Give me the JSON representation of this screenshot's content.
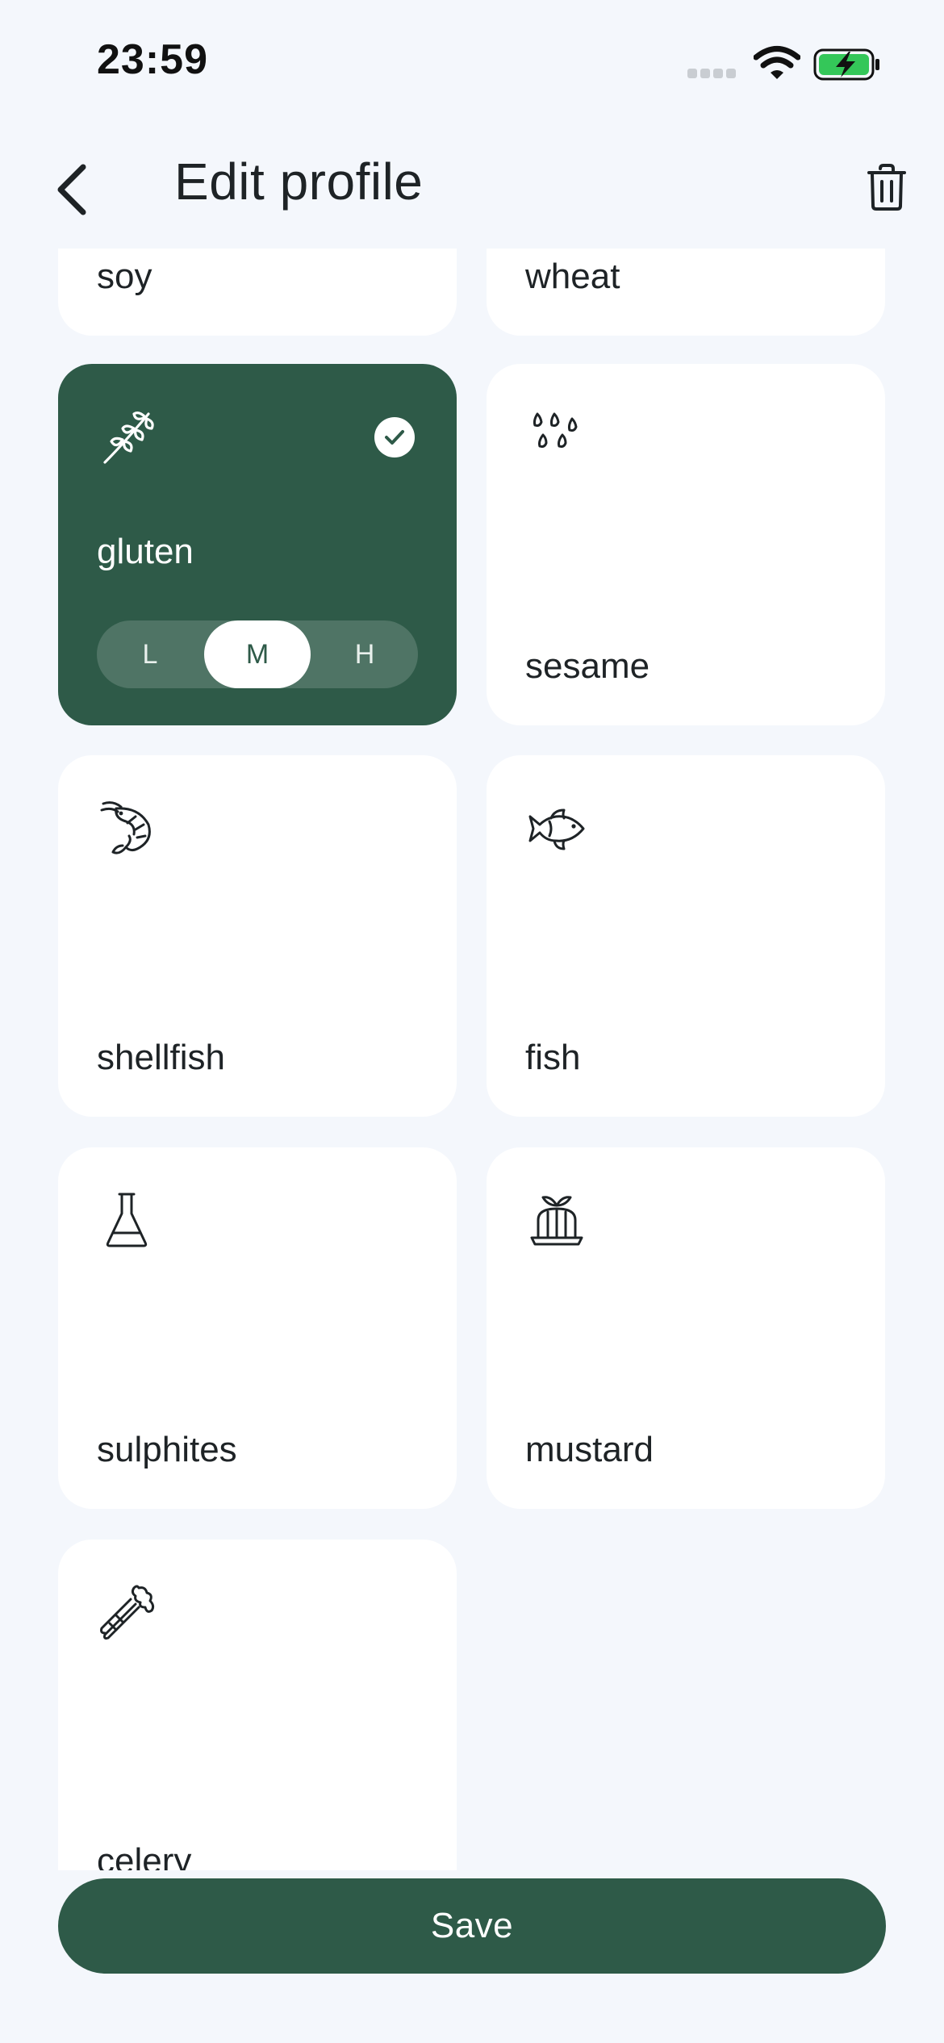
{
  "status_bar": {
    "time": "23:59"
  },
  "header": {
    "title": "Edit profile"
  },
  "allergens": [
    {
      "label": "soy",
      "icon": "soy-icon"
    },
    {
      "label": "wheat",
      "icon": "wheat-icon"
    },
    {
      "label": "gluten",
      "icon": "grain-icon",
      "selected": true,
      "levels": [
        "L",
        "M",
        "H"
      ],
      "selected_level": "M"
    },
    {
      "label": "sesame",
      "icon": "seeds-icon"
    },
    {
      "label": "shellfish",
      "icon": "shrimp-icon"
    },
    {
      "label": "fish",
      "icon": "fish-icon"
    },
    {
      "label": "sulphites",
      "icon": "flask-icon"
    },
    {
      "label": "mustard",
      "icon": "jelly-icon"
    },
    {
      "label": "celery",
      "icon": "celery-icon"
    }
  ],
  "save_label": "Save",
  "colors": {
    "accent": "#2E5A48",
    "background": "#F4F7FC",
    "card": "#FFFFFF",
    "battery": "#34C759"
  }
}
